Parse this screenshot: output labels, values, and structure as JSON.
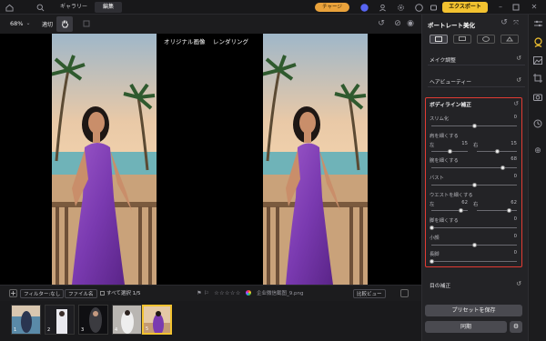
{
  "topbar": {
    "tabs": [
      "ギャラリー",
      "編集"
    ],
    "charge_label": "チャージ",
    "export_label": "エクスポート"
  },
  "toolbar": {
    "zoom": "68%",
    "fit_label": "適切"
  },
  "canvas": {
    "original_label": "オリジナル画像",
    "render_label": "レンダリング"
  },
  "filmbar": {
    "filter_label": "フィルター:なし",
    "filename_label": "ファイル名",
    "select_all_label": "すべて選択 1/5",
    "filename": "企业微信截图_9.png",
    "compare_label": "比較ビュー"
  },
  "thumbnails": [
    "1",
    "2",
    "3",
    "4",
    "5"
  ],
  "panel": {
    "title": "ポートレート美化",
    "sections": {
      "makeup": "メイク調整",
      "hair": "ヘアビューティー",
      "body": "ボディライン補正",
      "eyes": "目の補正"
    },
    "sliders": [
      {
        "label": "スリム化",
        "value": "0",
        "level": 0.5
      },
      {
        "label": "肩を細くする",
        "left_label": "左",
        "left_value": "15",
        "right_label": "右",
        "right_value": "15",
        "left_level": 0.5,
        "right_level": 0.5
      },
      {
        "label": "腕を細くする",
        "value": "68",
        "level": 0.84
      },
      {
        "label": "バスト",
        "value": "0",
        "level": 0.5
      },
      {
        "label": "ウエストを細くする",
        "left_label": "左",
        "left_value": "62",
        "right_label": "右",
        "right_value": "62",
        "left_level": 0.81,
        "right_level": 0.81
      },
      {
        "label": "脚を細くする",
        "value": "0",
        "level": 0.0
      },
      {
        "label": "小顔",
        "value": "0",
        "level": 0.5
      },
      {
        "label": "長脚",
        "value": "0",
        "level": 0.0
      }
    ],
    "save_preset_label": "プリセットを保存",
    "sync_label": "同期"
  },
  "colors": {
    "accent": "#f2c230",
    "highlight": "#e23b33"
  }
}
